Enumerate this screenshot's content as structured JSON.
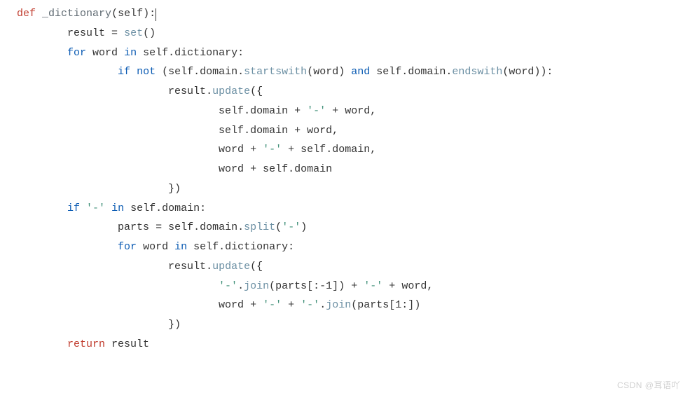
{
  "code": {
    "tokens": {
      "def": "def",
      "fn_name": "_dictionary",
      "self": "self",
      "result": "result",
      "eq": "=",
      "set_fn": "set",
      "for": "for",
      "word": "word",
      "in": "in",
      "dictionary": "dictionary",
      "if": "if",
      "not": "not",
      "domain": "domain",
      "startswith": "startswith",
      "and": "and",
      "endswith": "endswith",
      "update": "update",
      "plus": "+",
      "dash_lit": "'-'",
      "comma": ",",
      "lbrace": "{",
      "rbrace": "}",
      "lparen": "(",
      "rparen": ")",
      "colon": ":",
      "dot": ".",
      "parts": "parts",
      "split": "split",
      "join": "join",
      "lbracket": "[",
      "rbracket": "]",
      "neg1": "-1",
      "one": "1",
      "return": "return"
    }
  },
  "watermark": "CSDN @耳语吖"
}
